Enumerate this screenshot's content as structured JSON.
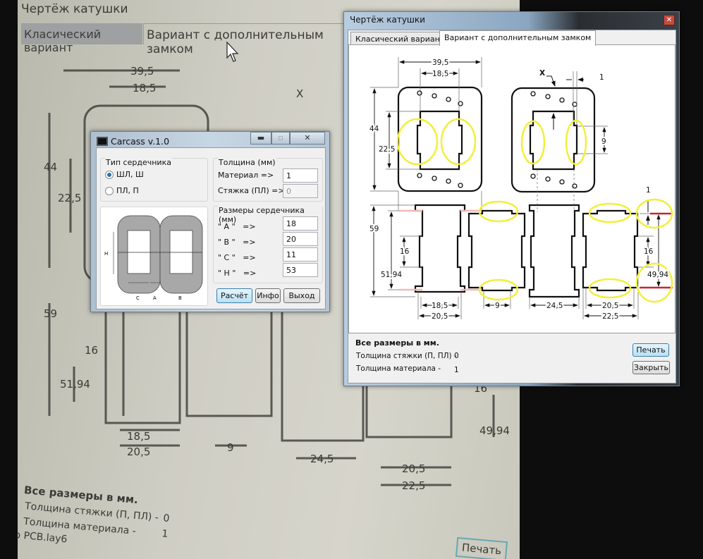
{
  "background_screen": {
    "title": "Чертёж катушки",
    "tabs": [
      "Класический вариант",
      "Вариант с дополнительным замком"
    ],
    "dims": [
      "39,5",
      "18,5",
      "X",
      "44",
      "22,5",
      "59",
      "16",
      "51,94",
      "18,5",
      "20,5",
      "9",
      "24,5",
      "20,5",
      "22,5",
      "16",
      "49,94"
    ],
    "note_title": "Все размеры в мм.",
    "tie_thickness_label": "Толщина стяжки (П, ПЛ) -",
    "tie_thickness_value": "0",
    "material_thickness_label": "Толщина материала -",
    "material_thickness_value": "1",
    "file_label": "о PCB.lay6",
    "print_button": "Печать"
  },
  "drawing_window": {
    "title": "Чертёж катушки",
    "close_icon": "close-icon",
    "tabs": [
      {
        "label": "Класический вариант",
        "active": false
      },
      {
        "label": "Вариант с дополнительным замком",
        "active": true
      }
    ],
    "dims": {
      "w_outer": "39,5",
      "w_inner": "18,5",
      "h_outer": "44",
      "h_inner": "22,5",
      "x_mark": "X",
      "gap_1": "1",
      "notch_9": "9",
      "h_59": "59",
      "h_16": "16",
      "h_5194": "51,94",
      "b_185": "18,5",
      "b_205": "20,5",
      "b_9": "9",
      "b_245": "24,5",
      "r_205": "20,5",
      "r_225": "22,5",
      "r_1": "1",
      "r_16": "16",
      "r_4994": "49,94"
    },
    "note_title": "Все размеры в мм.",
    "tie_thickness_label": "Толщина стяжки (П, ПЛ) -",
    "tie_thickness_value": "0",
    "material_thickness_label": "Толщина материала -",
    "material_thickness_value": "1",
    "print_button": "Печать",
    "close_button": "Закрыть",
    "colors": {
      "highlight": "#f2ef3a",
      "red_line": "#c8262b",
      "pink_line": "#f2b8b8"
    }
  },
  "carcass_window": {
    "title": "Carcass v.1.0",
    "core_type": {
      "legend": "Тип сердечника",
      "options": [
        {
          "label": "ШЛ, Ш",
          "selected": true
        },
        {
          "label": "ПЛ, П",
          "selected": false
        }
      ]
    },
    "diagram_labels": {
      "h": "H",
      "c": "C",
      "a": "A",
      "b": "B"
    },
    "thickness": {
      "legend": "Толщина (мм)",
      "material_label": "Материал =>",
      "material_value": "1",
      "tie_label": "Стяжка (ПЛ) =>",
      "tie_value": "0"
    },
    "core_size": {
      "legend": "Размеры сердечника (мм)",
      "fields": [
        {
          "label": "\" A \"   =>",
          "value": "18"
        },
        {
          "label": "\" B \"   =>",
          "value": "20"
        },
        {
          "label": "\" C \"   =>",
          "value": "11"
        },
        {
          "label": "\" H \"   =>",
          "value": "53"
        }
      ]
    },
    "buttons": {
      "calculate": "Расчёт",
      "info": "Инфо",
      "exit": "Выход"
    }
  }
}
